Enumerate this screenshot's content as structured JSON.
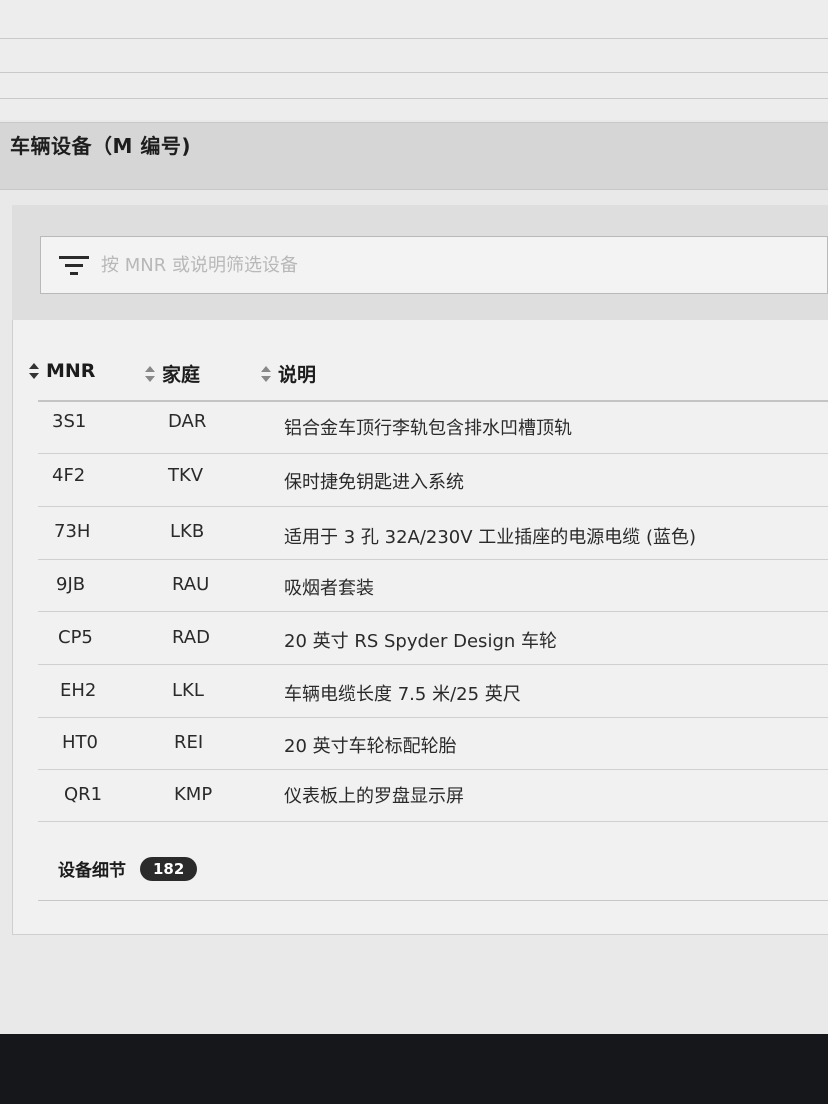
{
  "section": {
    "title": "车辆设备（M 编号)"
  },
  "filter": {
    "placeholder": "按 MNR 或说明筛选设备",
    "value": ""
  },
  "table": {
    "headers": {
      "mnr": "MNR",
      "family": "家庭",
      "description": "说明"
    },
    "rows": [
      {
        "mnr": "3S1",
        "family": "DAR",
        "description": "铝合金车顶行李轨包含排水凹槽顶轨"
      },
      {
        "mnr": "4F2",
        "family": "TKV",
        "description": "保时捷免钥匙进入系统"
      },
      {
        "mnr": "73H",
        "family": "LKB",
        "description": "适用于 3 孔 32A/230V 工业插座的电源电缆 (蓝色)"
      },
      {
        "mnr": "9JB",
        "family": "RAU",
        "description": "吸烟者套装"
      },
      {
        "mnr": "CP5",
        "family": "RAD",
        "description": "20 英寸 RS Spyder Design 车轮"
      },
      {
        "mnr": "EH2",
        "family": "LKL",
        "description": "车辆电缆长度 7.5 米/25 英尺"
      },
      {
        "mnr": "HT0",
        "family": "REI",
        "description": "20 英寸车轮标配轮胎"
      },
      {
        "mnr": "QR1",
        "family": "KMP",
        "description": "仪表板上的罗盘显示屏"
      }
    ]
  },
  "details": {
    "label": "设备细节",
    "count": "182"
  },
  "icons": {
    "filter": "filter-icon",
    "sort": "sort-icon"
  },
  "colors": {
    "badge_bg": "#2b2b2b",
    "header_bg": "#d6d6d6"
  }
}
